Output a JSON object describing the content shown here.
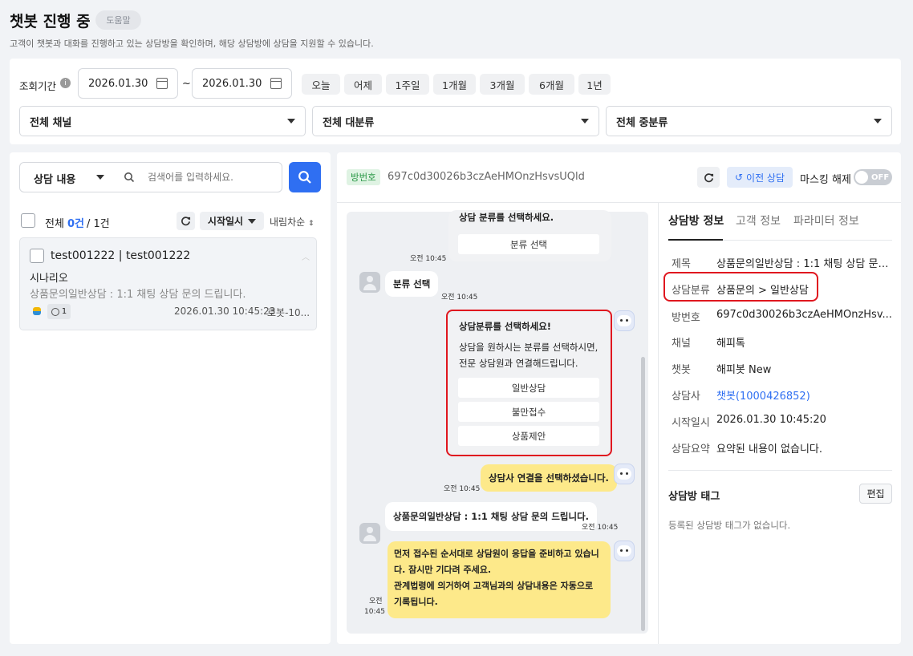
{
  "header": {
    "title": "챗봇 진행 중",
    "help_label": "도움말",
    "subtitle": "고객이 챗봇과 대화를 진행하고 있는 상담방을 확인하며, 해당 상담방에 상담을 지원할 수 있습니다."
  },
  "filter": {
    "period_label": "조회기간",
    "date_from": "2026.01.30",
    "date_to": "2026.01.30",
    "tilde": "~",
    "quick_ranges": [
      "오늘",
      "어제",
      "1주일",
      "1개월",
      "3개월",
      "6개월",
      "1년"
    ],
    "channel_select": "전체 채널",
    "major_category_select": "전체 대분류",
    "mid_category_select": "전체 중분류"
  },
  "list_panel": {
    "search_type": "상담 내용",
    "search_placeholder": "검색어를 입력하세요.",
    "total_label": "전체",
    "selected_count": "0건",
    "total_count": "/ 1건",
    "sort_field": "시작일시",
    "sort_order": "내림차순",
    "items": [
      {
        "title": "test001222 | test001222",
        "scenario": "시나리오",
        "summary": "상품문의일반상담 : 1:1 채팅 상담 문의 드립니다.",
        "badge_count": "1",
        "datetime": "2026.01.30 10:45:23",
        "agent": "로봇-10..."
      }
    ]
  },
  "chat_header": {
    "room_badge": "방번호",
    "room_id": "697c0d30026b3czAeHMOnzHsvsUQld",
    "prev_consult_label": "이전 상담",
    "masking_label": "마스킹 해제",
    "toggle_state": "OFF"
  },
  "chat": {
    "msg1_text": "상담 분류를 선택하세요.",
    "msg1_button": "분류 선택",
    "msg1_time": "오전 10:45",
    "msg2_text": "분류 선택",
    "msg2_time": "오전 10:45",
    "msg3_title": "상담분류를 선택하세요!",
    "msg3_body": "상담을 원하시는 분류를 선택하시면, 전문 상담원과 연결해드립니다.",
    "msg3_options": [
      "일반상담",
      "불만접수",
      "상품제안"
    ],
    "msg4_text": "상담사 연결을 선택하셨습니다.",
    "msg4_time": "오전 10:45",
    "msg5_text": "상품문의일반상담 : 1:1 채팅 상담 문의 드립니다.",
    "msg5_time": "오전 10:45",
    "msg6_text": "먼저 접수된 순서대로 상담원이 응답을 준비하고 있습니다. 잠시만 기다려 주세요.\n관계법령에 의거하여 고객님과의 상담내용은 자동으로 기록됩니다.",
    "msg6_time_a": "오전",
    "msg6_time_b": "10:45"
  },
  "info_panel": {
    "tabs": [
      "상담방 정보",
      "고객 정보",
      "파라미터 정보"
    ],
    "rows": [
      {
        "label": "제목",
        "value": "상품문의일반상담 : 1:1 채팅 상담 문의 ..."
      },
      {
        "label": "상담분류",
        "value": "상품문의 > 일반상담"
      },
      {
        "label": "방번호",
        "value": "697c0d30026b3czAeHMOnzHsv..."
      },
      {
        "label": "채널",
        "value": "해피톡"
      },
      {
        "label": "챗봇",
        "value": "해피봇 New"
      },
      {
        "label": "상담사",
        "value": "챗봇(1000426852)"
      },
      {
        "label": "시작일시",
        "value": "2026.01.30 10:45:20"
      },
      {
        "label": "상담요약",
        "value": "요약된 내용이 없습니다."
      }
    ],
    "tag_title": "상담방 태그",
    "tag_edit": "편집",
    "tag_empty": "등록된 상담방 태그가 없습니다."
  },
  "colors": {
    "accent": "#2f6ff2",
    "highlight_frame": "#e0171f",
    "bot_bubble": "#fde98a",
    "room_badge_bg": "#dff3e3",
    "room_badge_text": "#2e9a4a"
  }
}
